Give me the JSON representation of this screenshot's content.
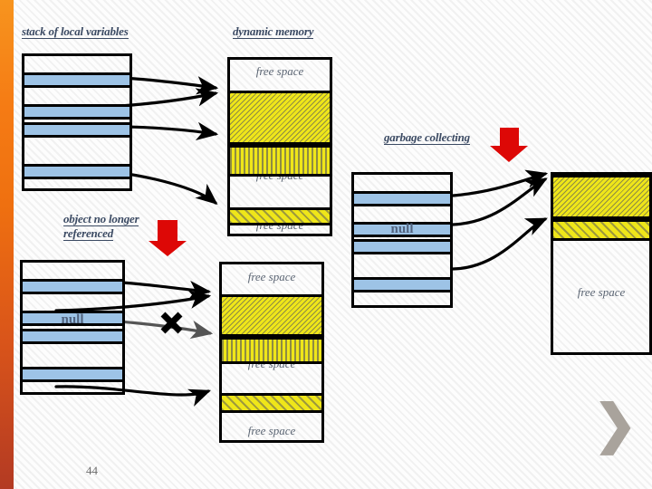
{
  "slide": {
    "page_number": "44",
    "next_icon": "chevron-right-icon",
    "accent_color": "#f57b14",
    "object_color": "#efe619",
    "reference_color": "#9dc3e6",
    "arrow_color": "#dd0806"
  },
  "labels": {
    "stack_title": "stack of local variables",
    "heap_title": "dynamic memory",
    "object_no_longer_referenced_line1": "object no longer",
    "object_no_longer_referenced_line2": "referenced",
    "garbage_collecting": "garbage collecting",
    "null_value": "null",
    "free_space": "free space"
  },
  "stacks": [
    {
      "id": "stack-before",
      "slots": [
        {
          "type": "empty"
        },
        {
          "type": "reference",
          "value": ""
        },
        {
          "type": "empty"
        },
        {
          "type": "reference",
          "value": ""
        },
        {
          "type": "reference",
          "value": ""
        },
        {
          "type": "empty"
        },
        {
          "type": "reference",
          "value": ""
        },
        {
          "type": "empty"
        }
      ]
    },
    {
      "id": "stack-dereferenced",
      "slots": [
        {
          "type": "empty"
        },
        {
          "type": "reference",
          "value": ""
        },
        {
          "type": "empty"
        },
        {
          "type": "reference",
          "value": ""
        },
        {
          "type": "reference",
          "value": "null"
        },
        {
          "type": "empty"
        },
        {
          "type": "reference",
          "value": ""
        },
        {
          "type": "empty"
        }
      ]
    },
    {
      "id": "stack-after-gc",
      "slots": [
        {
          "type": "empty"
        },
        {
          "type": "reference",
          "value": ""
        },
        {
          "type": "empty"
        },
        {
          "type": "reference",
          "value": ""
        },
        {
          "type": "reference",
          "value": "null"
        },
        {
          "type": "empty"
        },
        {
          "type": "reference",
          "value": ""
        },
        {
          "type": "empty"
        }
      ]
    }
  ],
  "heaps": [
    {
      "id": "heap-before",
      "segments": [
        {
          "kind": "free",
          "label": "free space"
        },
        {
          "kind": "object",
          "fill": "hatch-diagonal"
        },
        {
          "kind": "object",
          "fill": "hatch-vertical"
        },
        {
          "kind": "free",
          "label": "free space"
        },
        {
          "kind": "object",
          "fill": "hatch-rising"
        },
        {
          "kind": "free",
          "label": "free space"
        }
      ]
    },
    {
      "id": "heap-dereferenced",
      "segments": [
        {
          "kind": "free",
          "label": "free space"
        },
        {
          "kind": "object",
          "fill": "hatch-diagonal"
        },
        {
          "kind": "object",
          "fill": "hatch-vertical"
        },
        {
          "kind": "free",
          "label": "free space"
        },
        {
          "kind": "object",
          "fill": "hatch-rising"
        },
        {
          "kind": "free",
          "label": "free space"
        }
      ]
    },
    {
      "id": "heap-compacted",
      "segments": [
        {
          "kind": "object",
          "fill": "hatch-diagonal"
        },
        {
          "kind": "object",
          "fill": "hatch-rising"
        },
        {
          "kind": "free",
          "label": "free space"
        }
      ]
    }
  ]
}
